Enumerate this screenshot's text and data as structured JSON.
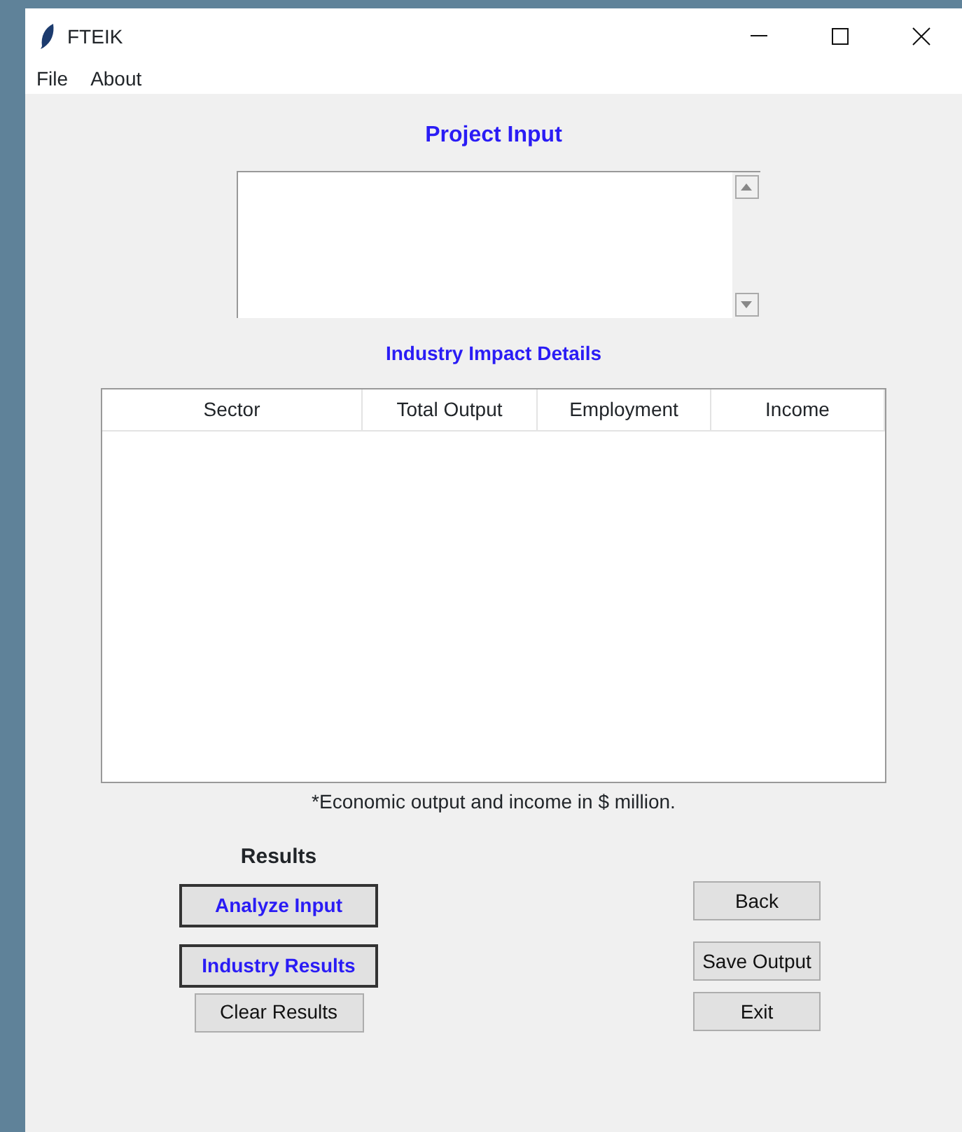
{
  "window": {
    "title": "FTEIK"
  },
  "menu": [
    "File",
    "About"
  ],
  "project_input": {
    "heading": "Project Input"
  },
  "impact": {
    "heading": "Industry Impact Details",
    "columns": [
      "Sector",
      "Total Output",
      "Employment",
      "Income"
    ],
    "note": "*Economic output and income in $ million."
  },
  "results": {
    "heading": "Results",
    "left_buttons": [
      {
        "label": "Analyze Input",
        "kind": "emphasized"
      },
      {
        "label": "Industry Results",
        "kind": "emphasized"
      },
      {
        "label": "Clear Results",
        "kind": "plain"
      }
    ],
    "right_buttons": [
      {
        "label": "Back",
        "kind": "plain"
      },
      {
        "label": "Save Output",
        "kind": "plain"
      },
      {
        "label": "Exit",
        "kind": "plain"
      }
    ]
  }
}
